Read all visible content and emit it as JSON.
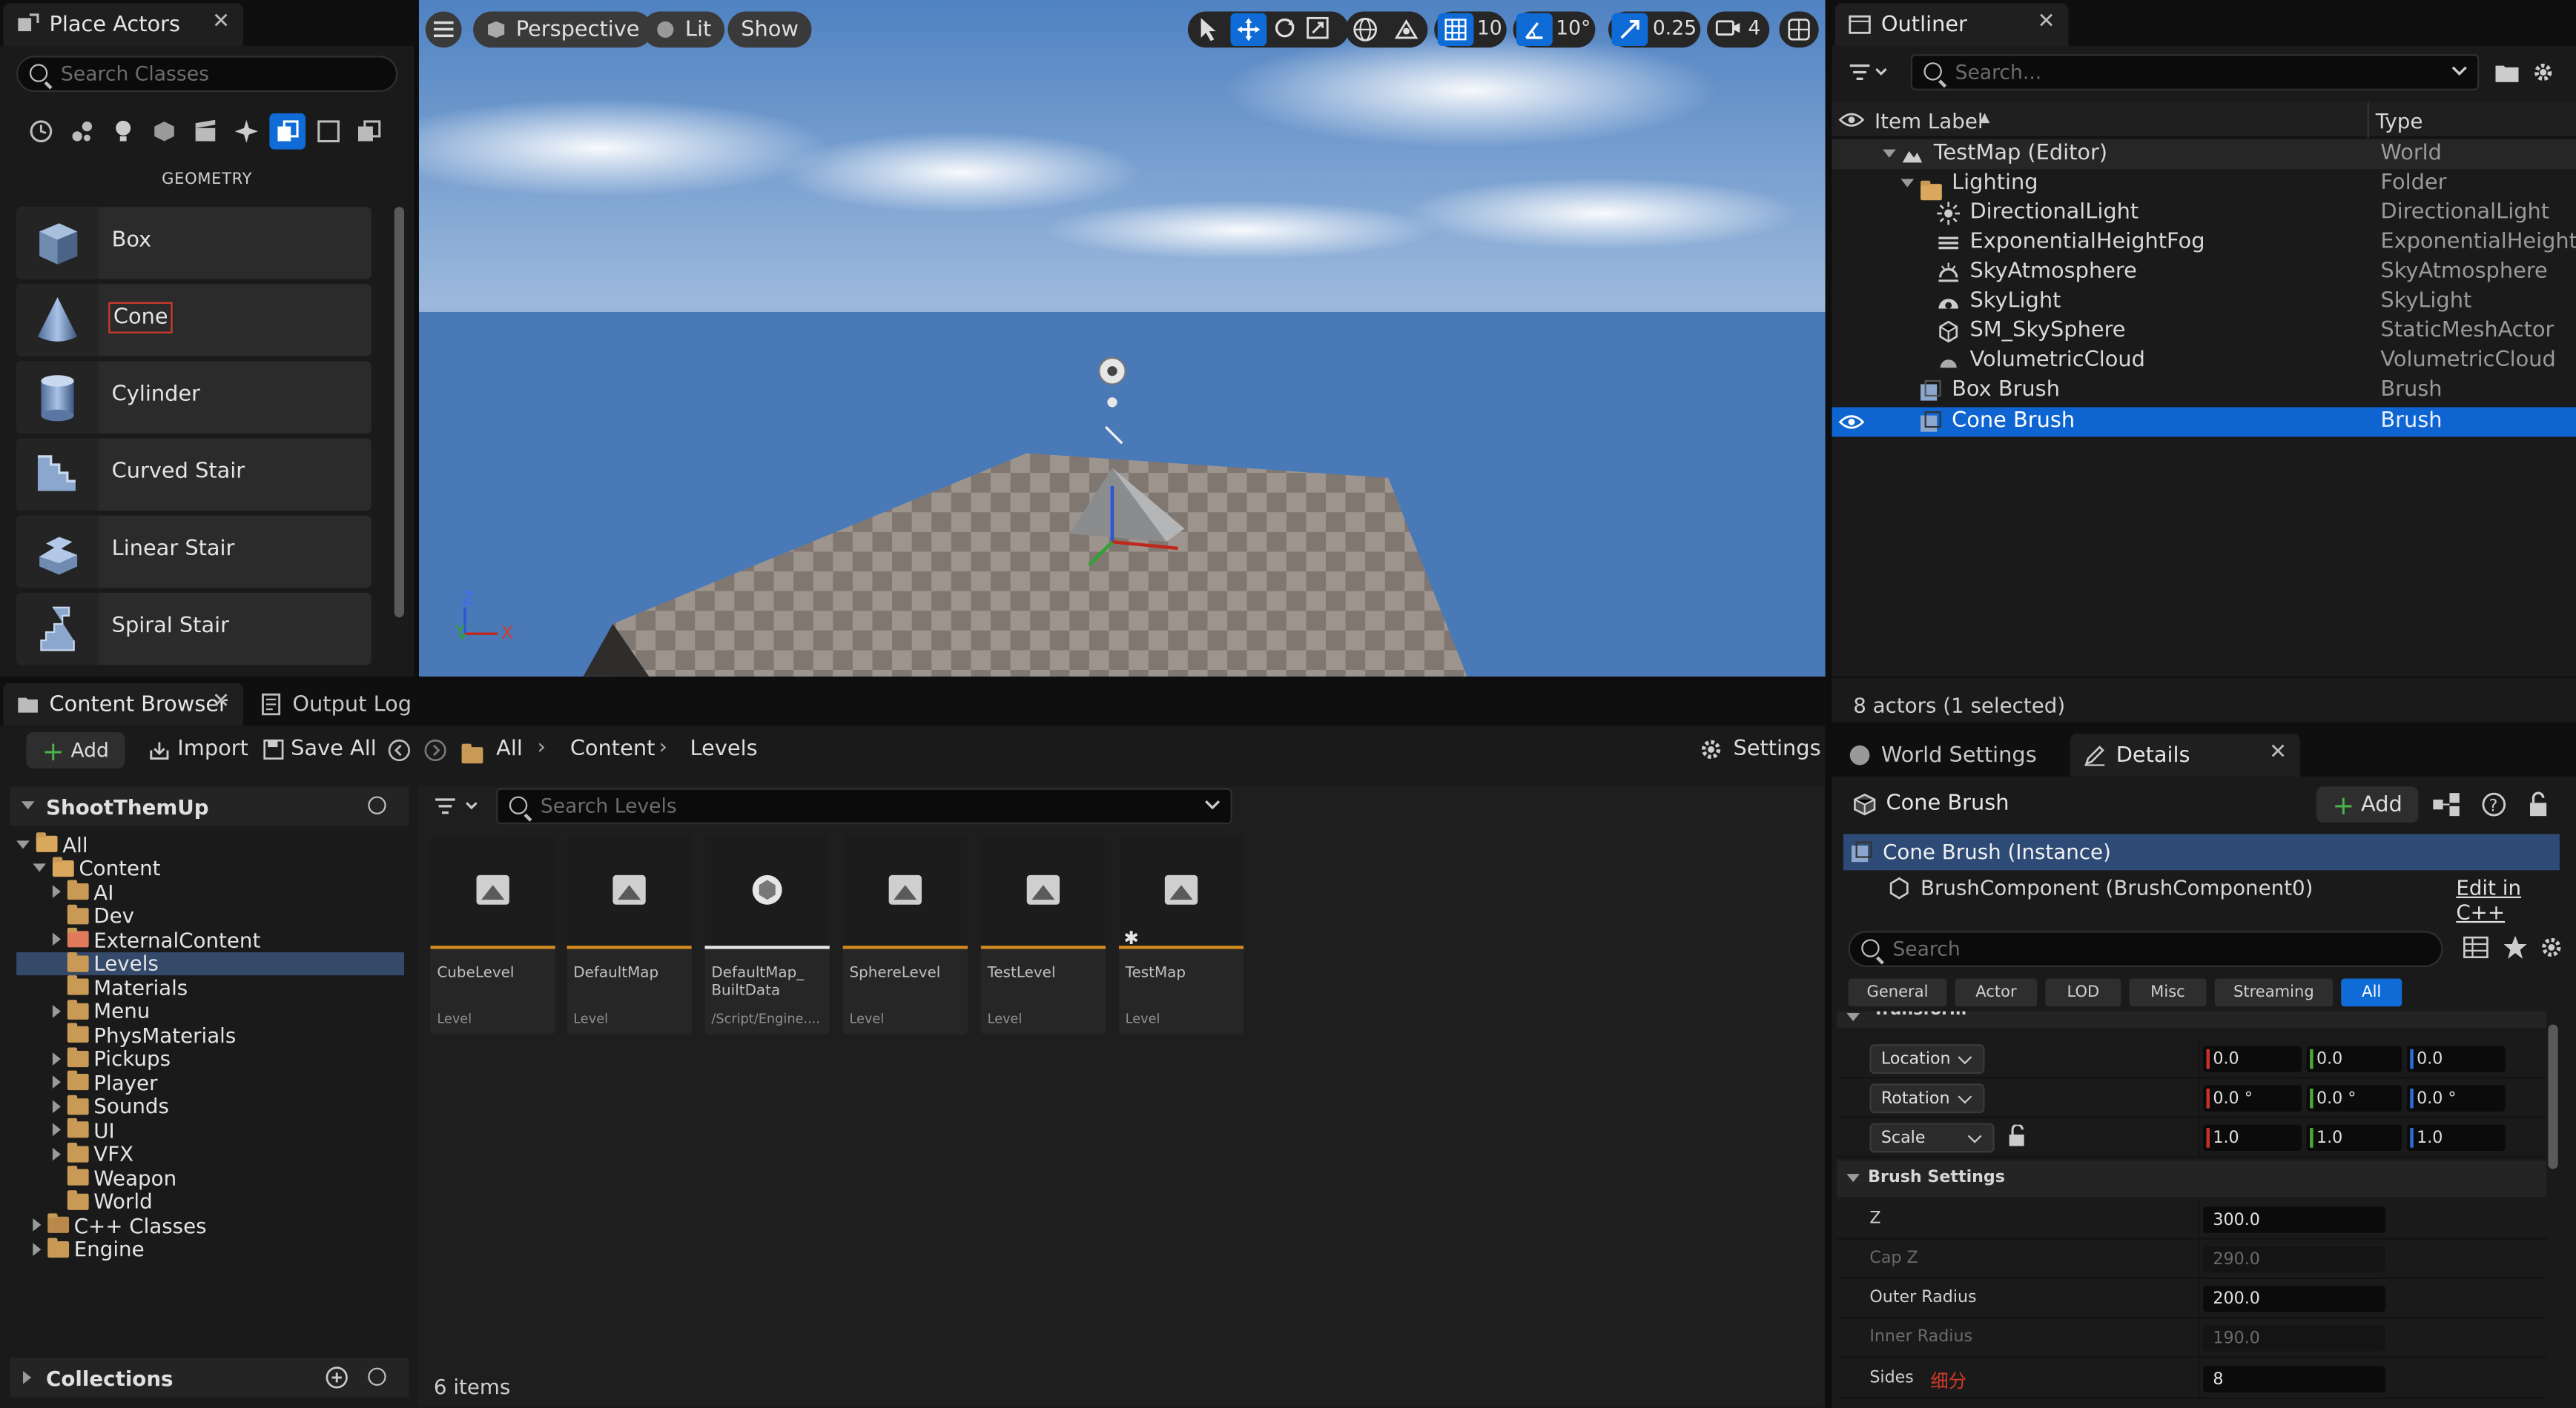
{
  "place_actors": {
    "tab_label": "Place Actors",
    "search_placeholder": "Search Classes",
    "section_title": "GEOMETRY",
    "items": [
      {
        "label": "Box"
      },
      {
        "label": "Cone"
      },
      {
        "label": "Cylinder"
      },
      {
        "label": "Curved Stair"
      },
      {
        "label": "Linear Stair"
      },
      {
        "label": "Spiral Stair"
      }
    ]
  },
  "viewport": {
    "perspective_label": "Perspective",
    "lit_label": "Lit",
    "show_label": "Show",
    "grid_snap": "10",
    "rotation_snap": "10°",
    "scale_snap": "0.25",
    "camera_speed": "4",
    "axis_z": "Z",
    "axis_y": "Y",
    "axis_x": "X"
  },
  "outliner": {
    "tab_label": "Outliner",
    "search_placeholder": "Search...",
    "col_label": "Item Label",
    "col_type": "Type",
    "rows": [
      {
        "label": "TestMap (Editor)",
        "type": "World"
      },
      {
        "label": "Lighting",
        "type": "Folder"
      },
      {
        "label": "DirectionalLight",
        "type": "DirectionalLight"
      },
      {
        "label": "ExponentialHeightFog",
        "type": "ExponentialHeightFog"
      },
      {
        "label": "SkyAtmosphere",
        "type": "SkyAtmosphere"
      },
      {
        "label": "SkyLight",
        "type": "SkyLight"
      },
      {
        "label": "SM_SkySphere",
        "type": "StaticMeshActor"
      },
      {
        "label": "VolumetricCloud",
        "type": "VolumetricCloud"
      },
      {
        "label": "Box Brush",
        "type": "Brush"
      },
      {
        "label": "Cone Brush",
        "type": "Brush"
      }
    ],
    "status": "8 actors (1 selected)"
  },
  "content_browser": {
    "tab_label": "Content Browser",
    "output_log_label": "Output Log",
    "add_label": "Add",
    "import_label": "Import",
    "save_all_label": "Save All",
    "path": [
      "All",
      "Content",
      "Levels"
    ],
    "settings_label": "Settings",
    "project_name": "ShootThemUp",
    "search_placeholder": "Search Levels",
    "tree": [
      {
        "label": "All"
      },
      {
        "label": "Content"
      },
      {
        "label": "AI"
      },
      {
        "label": "Dev"
      },
      {
        "label": "ExternalContent"
      },
      {
        "label": "Levels"
      },
      {
        "label": "Materials"
      },
      {
        "label": "Menu"
      },
      {
        "label": "PhysMaterials"
      },
      {
        "label": "Pickups"
      },
      {
        "label": "Player"
      },
      {
        "label": "Sounds"
      },
      {
        "label": "UI"
      },
      {
        "label": "VFX"
      },
      {
        "label": "Weapon"
      },
      {
        "label": "World"
      },
      {
        "label": "C++ Classes"
      },
      {
        "label": "Engine"
      }
    ],
    "collections_label": "Collections",
    "assets": [
      {
        "name": "CubeLevel",
        "type": "Level"
      },
      {
        "name": "DefaultMap",
        "type": "Level"
      },
      {
        "name": "DefaultMap_ BuiltData",
        "type": "/Script/Engine...."
      },
      {
        "name": "SphereLevel",
        "type": "Level"
      },
      {
        "name": "TestLevel",
        "type": "Level"
      },
      {
        "name": "TestMap",
        "type": "Level"
      }
    ],
    "item_count": "6 items"
  },
  "details": {
    "world_settings_label": "World Settings",
    "tab_label": "Details",
    "actor_name": "Cone Brush",
    "add_label": "Add",
    "instance_label": "Cone Brush (Instance)",
    "component_label": "BrushComponent (BrushComponent0)",
    "edit_cpp_label": "Edit in C++",
    "search_placeholder": "Search",
    "filters": [
      "General",
      "Actor",
      "LOD",
      "Misc",
      "Streaming",
      "All"
    ],
    "transform_section": "Transform",
    "location_label": "Location",
    "rotation_label": "Rotation",
    "scale_label": "Scale",
    "location": [
      "0.0",
      "0.0",
      "0.0"
    ],
    "rotation": [
      "0.0 °",
      "0.0 °",
      "0.0 °"
    ],
    "scale": [
      "1.0",
      "1.0",
      "1.0"
    ],
    "brush_section": "Brush Settings",
    "brush": [
      {
        "label": "Z",
        "value": "300.0"
      },
      {
        "label": "Cap Z",
        "value": "290.0"
      },
      {
        "label": "Outer Radius",
        "value": "200.0"
      },
      {
        "label": "Inner Radius",
        "value": "190.0"
      },
      {
        "label": "Sides",
        "value": "8"
      }
    ],
    "sides_annotation": "细分"
  },
  "colors": {
    "accent": "#0f6cd6",
    "selection": "#0e64d0",
    "level_bar": "#d48a1e",
    "highlight_box": "#d23a2a"
  }
}
